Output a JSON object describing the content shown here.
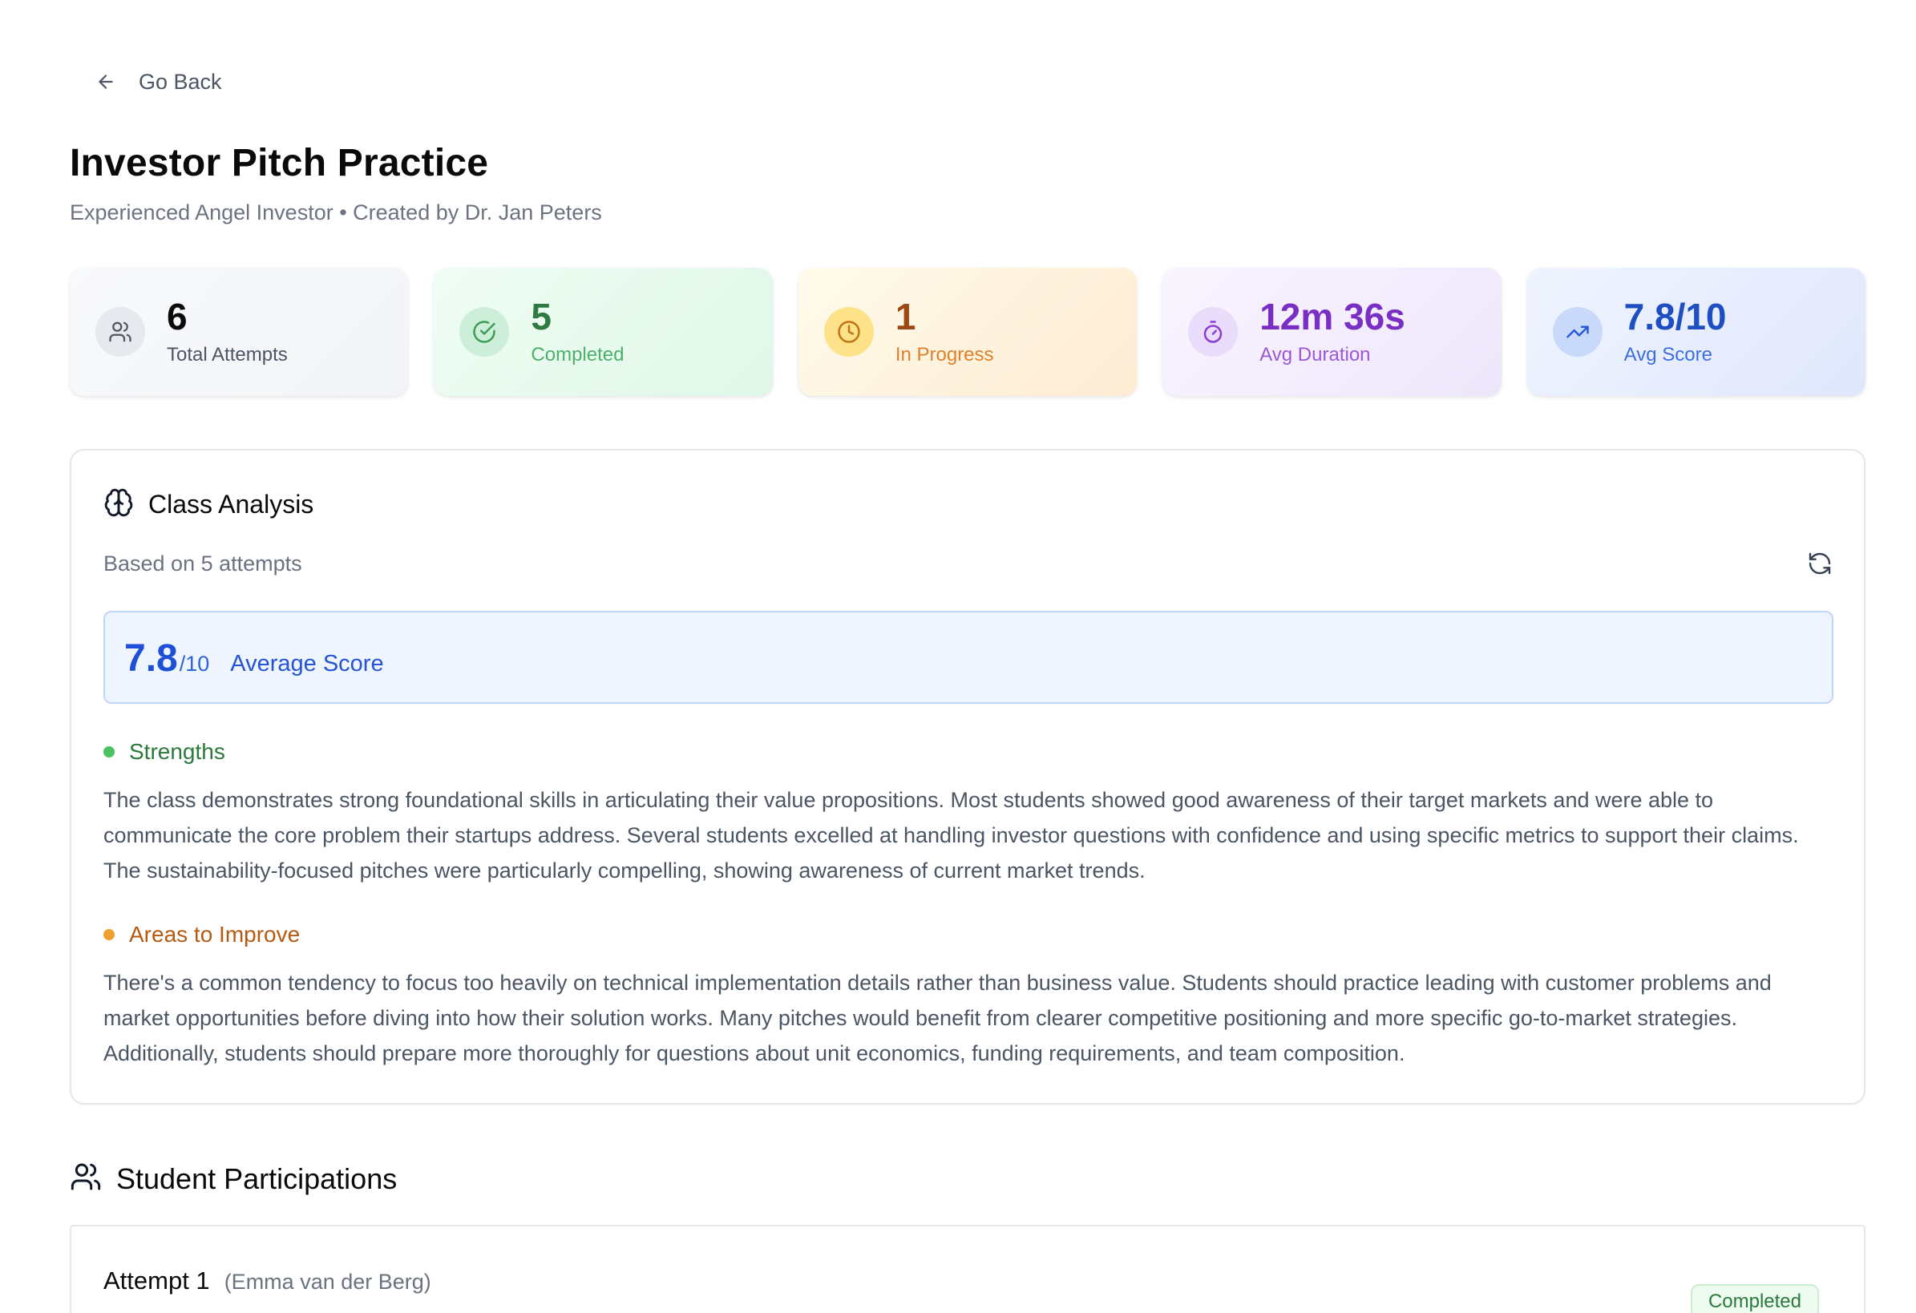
{
  "nav": {
    "back_label": "Go Back",
    "back_icon": "arrow-left-icon"
  },
  "header": {
    "title": "Investor Pitch Practice",
    "subtitle": "Experienced Angel Investor • Created by Dr. Jan Peters"
  },
  "stats": [
    {
      "value": "6",
      "label": "Total Attempts",
      "icon": "users-icon"
    },
    {
      "value": "5",
      "label": "Completed",
      "icon": "check-circle-icon"
    },
    {
      "value": "1",
      "label": "In Progress",
      "icon": "clock-icon"
    },
    {
      "value": "12m 36s",
      "label": "Avg Duration",
      "icon": "timer-icon"
    },
    {
      "value": "7.8/10",
      "label": "Avg Score",
      "icon": "trending-up-icon"
    }
  ],
  "analysis": {
    "title": "Class Analysis",
    "based_on": "Based on 5 attempts",
    "score": {
      "value": "7.8",
      "denominator": "/10",
      "label": "Average Score"
    },
    "strengths": {
      "label": "Strengths",
      "text": "The class demonstrates strong foundational skills in articulating their value propositions. Most students showed good awareness of their target markets and were able to communicate the core problem their startups address. Several students excelled at handling investor questions with confidence and using specific metrics to support their claims. The sustainability-focused pitches were particularly compelling, showing awareness of current market trends."
    },
    "improve": {
      "label": "Areas to Improve",
      "text": "There's a common tendency to focus too heavily on technical implementation details rather than business value. Students should practice leading with customer problems and market opportunities before diving into how their solution works. Many pitches would benefit from clearer competitive positioning and more specific go-to-market strategies. Additionally, students should prepare more thoroughly for questions about unit economics, funding requirements, and team composition."
    }
  },
  "participations": {
    "title": "Student Participations",
    "attempts": [
      {
        "title": "Attempt 1",
        "student": "(Emma van der Berg)",
        "status": "Completed"
      }
    ]
  },
  "colors": {
    "primary_blue": "#1d4fd8",
    "success_green": "#2b7a3c",
    "warning_orange": "#b65a12",
    "purple": "#7a2fc4"
  }
}
